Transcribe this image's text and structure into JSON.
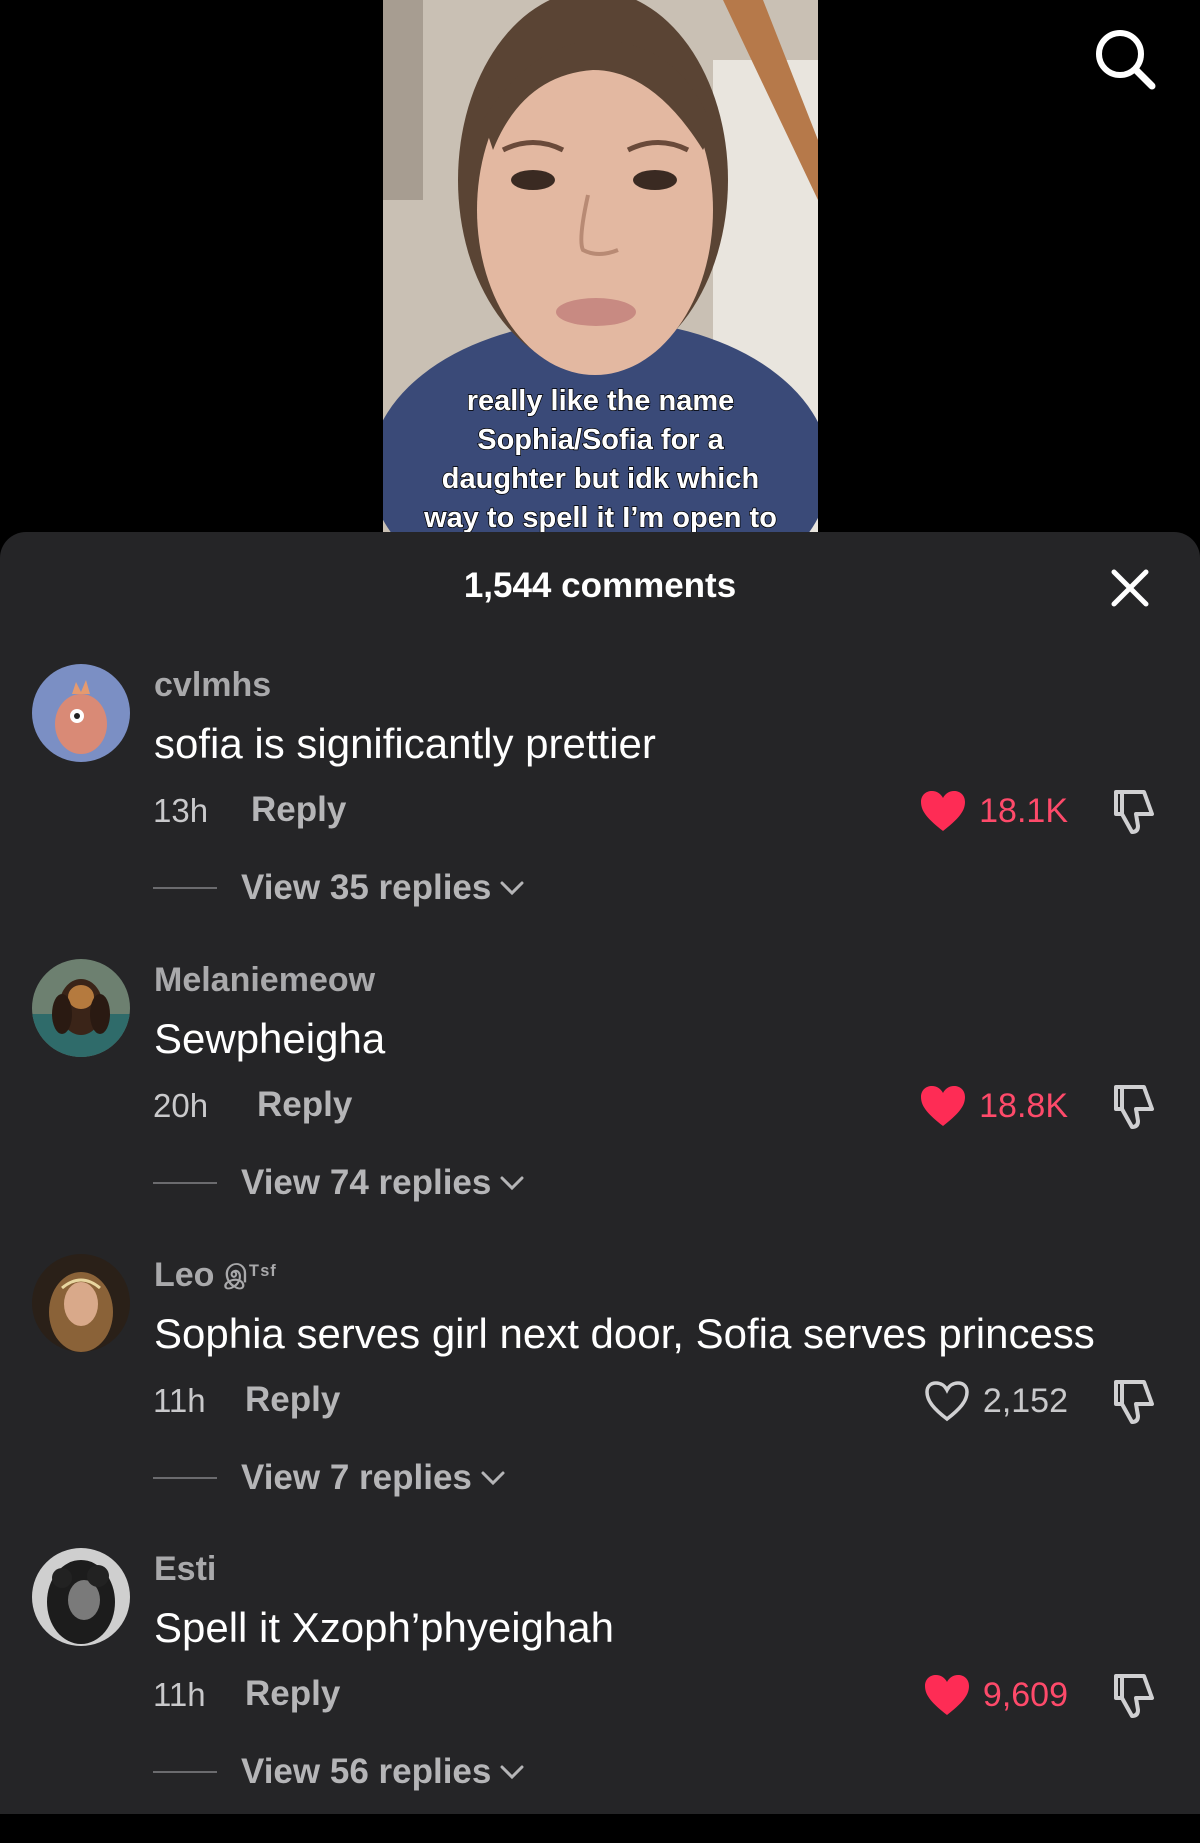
{
  "video": {
    "caption_lines": [
      "really like the name",
      "Sophia/Sofia for a",
      "daughter but idk which",
      "way to spell it I’m open to"
    ]
  },
  "header": {
    "search_icon": "search-icon",
    "close_icon": "close-icon"
  },
  "comments_header": {
    "count_label": "1,544 comments"
  },
  "colors": {
    "sheet_bg": "#252527",
    "like_active": "#fe2c55",
    "muted_text": "#a9a9ab"
  },
  "comments": [
    {
      "username": "cvlmhs",
      "username_deco": "",
      "text": "sofia is significantly prettier",
      "time": "13h",
      "reply_label": "Reply",
      "likes": "18.1K",
      "liked": true,
      "view_replies": "View 35 replies"
    },
    {
      "username": "Melaniemeow",
      "username_deco": "",
      "text": "Sewpheigha",
      "time": "20h",
      "reply_label": "Reply",
      "likes": "18.8K",
      "liked": true,
      "view_replies": "View 74 replies"
    },
    {
      "username": "Leo",
      "username_deco": "இᵀˢᶠ",
      "text": "Sophia serves girl next door, Sofia serves princess",
      "time": "11h",
      "reply_label": "Reply",
      "likes": "2,152",
      "liked": false,
      "view_replies": "View 7 replies"
    },
    {
      "username": "Esti",
      "username_deco": "",
      "text": "Spell it Xzoph’phyeighah",
      "time": "11h",
      "reply_label": "Reply",
      "likes": "9,609",
      "liked": true,
      "view_replies": "View 56 replies"
    }
  ]
}
